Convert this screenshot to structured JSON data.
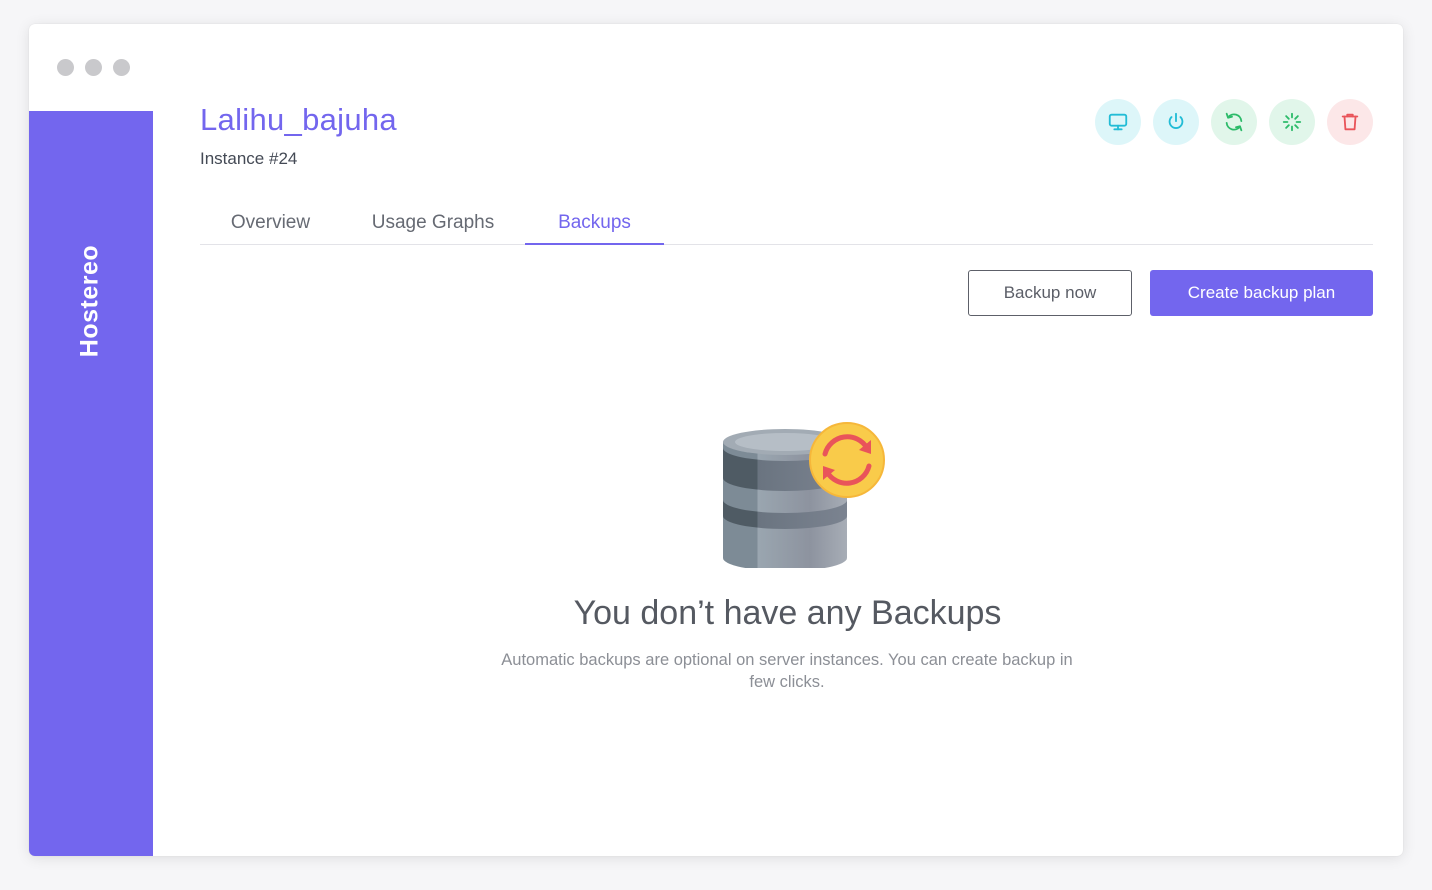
{
  "window": {
    "dots": [
      "#c9c9cc",
      "#c9c9cc",
      "#c9c9cc"
    ]
  },
  "sidebar": {
    "brand": "Hostereo",
    "color": "#7366ee"
  },
  "header": {
    "title": "Lalihu_bajuha",
    "subtitle": "Instance #24"
  },
  "actions": [
    {
      "icon": "monitor-icon",
      "color": "#22bcd6",
      "bg": "#ddf6f9"
    },
    {
      "icon": "power-icon",
      "color": "#22bcd6",
      "bg": "#ddf6f9"
    },
    {
      "icon": "refresh-icon",
      "color": "#2dbb6a",
      "bg": "#e1f6ea"
    },
    {
      "icon": "loader-icon",
      "color": "#2dbb6a",
      "bg": "#e1f6ea"
    },
    {
      "icon": "trash-icon",
      "color": "#e9545a",
      "bg": "#fce7e8"
    }
  ],
  "tabs": [
    {
      "label": "Overview",
      "active": false
    },
    {
      "label": "Usage Graphs",
      "active": false
    },
    {
      "label": "Backups",
      "active": true
    }
  ],
  "buttons": {
    "backup_now": "Backup now",
    "create_plan": "Create backup plan"
  },
  "empty_state": {
    "illustration": "database-backup-icon",
    "title": "You don’t have any Backups",
    "description": "Automatic backups are optional on server instances. You can create backup in few clicks."
  }
}
